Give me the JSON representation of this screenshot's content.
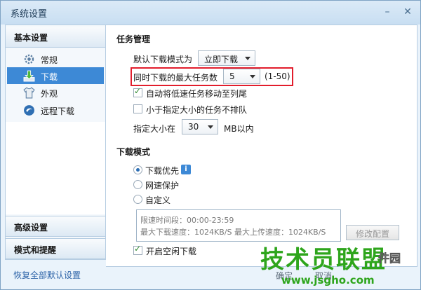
{
  "window": {
    "title": "系统设置"
  },
  "sidebar": {
    "groups": [
      {
        "label": "基本设置"
      },
      {
        "label": "高级设置"
      },
      {
        "label": "模式和提醒"
      }
    ],
    "items": [
      {
        "label": "常规",
        "icon": "gear-icon"
      },
      {
        "label": "下载",
        "icon": "download-icon",
        "active": true
      },
      {
        "label": "外观",
        "icon": "shirt-icon"
      },
      {
        "label": "远程下载",
        "icon": "remote-download-icon"
      }
    ],
    "restore_link": "恢复全部默认设置"
  },
  "task_management": {
    "title": "任务管理",
    "default_mode_label": "默认下载模式为",
    "default_mode_value": "立即下载",
    "max_tasks_label": "同时下载的最大任务数",
    "max_tasks_value": "5",
    "max_tasks_range": "(1-50)",
    "auto_move_slow": {
      "label": "自动将低速任务移动至列尾",
      "checked": true
    },
    "no_queue_small": {
      "label": "小于指定大小的任务不排队",
      "checked": false
    },
    "size_label": "指定大小在",
    "size_value": "30",
    "size_unit": "MB以内"
  },
  "download_mode": {
    "title": "下载模式",
    "options": [
      {
        "label": "下载优先",
        "selected": true
      },
      {
        "label": "网速保护",
        "selected": false
      },
      {
        "label": "自定义",
        "selected": false
      }
    ],
    "limit_period": "限速时间段：00:00-23:59",
    "limit_speeds": "最大下载速度：1024KB/S  最大上传速度：1024KB/S",
    "edit_button": "修改配置",
    "idle_download": {
      "label": "开启空闲下载",
      "checked": true
    }
  },
  "footer": {
    "ok_label": "确定",
    "cancel_label": "取消"
  },
  "watermark": {
    "brand": "技术员联盟",
    "url": "www.jsgho.com",
    "side": "件园"
  },
  "colors": {
    "highlight": "#e21d2c",
    "accent": "#3d89d6",
    "watermark": "#2ea51c"
  }
}
